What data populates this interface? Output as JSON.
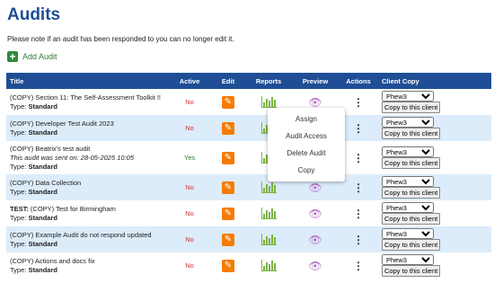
{
  "page": {
    "title": "Audits",
    "note": "Please note if an audit has been responded to you can no longer edit it.",
    "add_label": "Add Audit"
  },
  "table": {
    "headers": [
      "Title",
      "Active",
      "Edit",
      "Reports",
      "Preview",
      "Actions",
      "Client Copy"
    ],
    "rows": [
      {
        "title": "(COPY) Section 11: The Self-Assessment Toolkit !!",
        "title_bold": "",
        "sent": "",
        "type_label": "Type:",
        "type": "Standard",
        "active": "No",
        "client": "Phew3",
        "copy": "Copy to this client"
      },
      {
        "title": "(COPY) Developer Test Audit 2023",
        "title_bold": "",
        "sent": "",
        "type_label": "Type:",
        "type": "Standard",
        "active": "No",
        "client": "Phew3",
        "copy": "Copy to this client"
      },
      {
        "title": "(COPY) Beatrix's test audit",
        "title_bold": "",
        "sent": "This audit was sent on: 28-05-2025 10:05",
        "type_label": "Type:",
        "type": "Standard",
        "active": "Yes",
        "client": "Phew3",
        "copy": "Copy to this client"
      },
      {
        "title": "(COPY) Data Collection",
        "title_bold": "",
        "sent": "",
        "type_label": "Type:",
        "type": "Standard",
        "active": "No",
        "client": "Phew3",
        "copy": "Copy to this client"
      },
      {
        "title": " (COPY) Test for Birmingham",
        "title_bold": "TEST:",
        "sent": "",
        "type_label": "Type:",
        "type": "Standard",
        "active": "No",
        "client": "Phew3",
        "copy": "Copy to this client"
      },
      {
        "title": "(COPY) Example Audit do not respond updated",
        "title_bold": "",
        "sent": "",
        "type_label": "Type:",
        "type": "Standard",
        "active": "No",
        "client": "Phew3",
        "copy": "Copy to this client"
      },
      {
        "title": "(COPY) Actions and docs fix",
        "title_bold": "",
        "sent": "",
        "type_label": "Type:",
        "type": "Standard",
        "active": "No",
        "client": "Phew3",
        "copy": "Copy to this client"
      }
    ]
  },
  "menu": {
    "items": [
      "Assign",
      "Audit Access",
      "Delete Audit",
      "Copy"
    ]
  },
  "icons": {
    "add": "plus-icon",
    "edit": "pencil-icon",
    "reports": "bar-chart-icon",
    "preview": "eye-icon",
    "actions": "kebab-icon"
  },
  "colors": {
    "header": "#1f4e96",
    "row_alt": "#dcecfa",
    "no": "#d32f2f",
    "yes": "#2e7d32",
    "edit": "#f57c00",
    "reports": "#7cb342",
    "preview": "#b46fc4",
    "add": "#2e8b3a"
  }
}
